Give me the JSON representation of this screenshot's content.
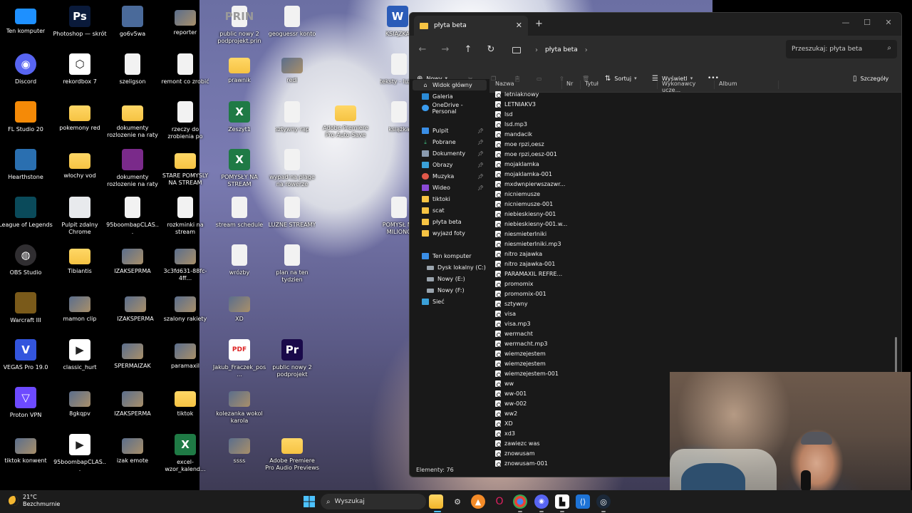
{
  "desktop": {
    "icons": [
      {
        "label": "Ten komputer",
        "icon": "monitor-icon",
        "color": "#1e90ff"
      },
      {
        "label": "Photoshop — skrót",
        "icon": "photoshop-icon",
        "color": "#0a1a3a",
        "glyph": "Ps"
      },
      {
        "label": "go6v5wa",
        "icon": "archive-icon",
        "color": "#4a6a9a"
      },
      {
        "label": "reporter",
        "icon": "image-icon"
      },
      {
        "label": "public nowy 2 podprojekt.prin",
        "icon": "file-icon",
        "glyph": "PRIN"
      },
      {
        "label": "geoguessr konto",
        "icon": "file-icon"
      },
      {
        "label": "KSIĄZKA",
        "icon": "word-icon",
        "glyph": "W"
      },
      {
        "label": "Discord",
        "icon": "discord-icon",
        "color": "#5865f2"
      },
      {
        "label": "rekordbox 7",
        "icon": "rekordbox-icon",
        "color": "#ffffff"
      },
      {
        "label": "szeligson",
        "icon": "file-icon"
      },
      {
        "label": "remont co zrobić",
        "icon": "file-icon"
      },
      {
        "label": "prawnik",
        "icon": "folder-icon"
      },
      {
        "label": "redi",
        "icon": "image-icon"
      },
      {
        "label": "teksty - luźne",
        "icon": "file-icon"
      },
      {
        "label": "FL Studio 20",
        "icon": "flstudio-icon",
        "color": "#f58a07"
      },
      {
        "label": "pokemony red",
        "icon": "folder-icon"
      },
      {
        "label": "dokumenty rozlozenie na raty",
        "icon": "folder-icon"
      },
      {
        "label": "rzeczy do zrobienia po wyplacie",
        "icon": "file-icon"
      },
      {
        "label": "Zeszyt1",
        "icon": "excel-icon",
        "glyph": "X"
      },
      {
        "label": "sztywny rap",
        "icon": "file-icon"
      },
      {
        "label": "Adobe Premiere Pro Auto-Save",
        "icon": "folder-icon"
      },
      {
        "label": "książka",
        "icon": "file-icon"
      },
      {
        "label": "Hearthstone",
        "icon": "hearthstone-icon",
        "color": "#2a6fb0"
      },
      {
        "label": "włochy vod",
        "icon": "folder-icon"
      },
      {
        "label": "dokumenty rozlozenie na raty",
        "icon": "winrar-icon",
        "color": "#7a2a8a"
      },
      {
        "label": "STARE POMYSLY NA STREAM",
        "icon": "folder-icon"
      },
      {
        "label": "POMYSŁY NA STREAM",
        "icon": "excel-icon",
        "glyph": "X"
      },
      {
        "label": "wypad na plage na rowerze",
        "icon": "file-icon"
      },
      {
        "label": "League of Legends",
        "icon": "lol-icon",
        "color": "#0a4a5a"
      },
      {
        "label": "Pulpit zdalny Chrome",
        "icon": "chrome-remote-icon",
        "color": "#e8eaed"
      },
      {
        "label": "95boombapCLAS...",
        "icon": "file-icon"
      },
      {
        "label": "rozkminki na stream",
        "icon": "file-icon"
      },
      {
        "label": "stream schedule",
        "icon": "file-icon"
      },
      {
        "label": "LUŹNE STREAMY",
        "icon": "file-icon"
      },
      {
        "label": "POMYSŁ NA MILIONG",
        "icon": "file-icon"
      },
      {
        "label": "OBS Studio",
        "icon": "obs-icon",
        "color": "#302e31"
      },
      {
        "label": "Tibiantis",
        "icon": "folder-icon"
      },
      {
        "label": "IZAKSEPRMA",
        "icon": "image-icon"
      },
      {
        "label": "3c3fd631-88fc-4ff...",
        "icon": "image-icon"
      },
      {
        "label": "wrózby",
        "icon": "file-icon"
      },
      {
        "label": "plan na ten tydzien",
        "icon": "file-icon"
      },
      {
        "label": "Warcraft III",
        "icon": "warcraft-icon",
        "color": "#7a5a1a"
      },
      {
        "label": "mamon clip",
        "icon": "image-icon"
      },
      {
        "label": "IZAKSPERMA",
        "icon": "image-icon"
      },
      {
        "label": "szalony rakiety",
        "icon": "image-icon"
      },
      {
        "label": "XD",
        "icon": "image-icon"
      },
      {
        "label": "VEGAS Pro 19.0",
        "icon": "vegas-icon",
        "color": "#3355dd",
        "glyph": "V"
      },
      {
        "label": "classic_hurt",
        "icon": "video-icon"
      },
      {
        "label": "SPERMAIZAK",
        "icon": "image-icon"
      },
      {
        "label": "paramaxil",
        "icon": "image-icon"
      },
      {
        "label": "Jakub_Fraczek_pos...",
        "icon": "pdf-icon",
        "glyph": "PDF"
      },
      {
        "label": "public nowy 2 podprojekt",
        "icon": "premiere-icon",
        "color": "#1a0a4a",
        "glyph": "Pr"
      },
      {
        "label": "Proton VPN",
        "icon": "protonvpn-icon",
        "color": "#6d4aff"
      },
      {
        "label": "8gkqpv",
        "icon": "image-icon"
      },
      {
        "label": "IZAKSPERMA",
        "icon": "image-icon"
      },
      {
        "label": "tiktok",
        "icon": "folder-icon"
      },
      {
        "label": "kolezanka wokol karola",
        "icon": "image-icon"
      },
      {
        "label": "tiktok konwent",
        "icon": "image-icon"
      },
      {
        "label": "95boombapCLAS...",
        "icon": "video-icon"
      },
      {
        "label": "izak emote",
        "icon": "image-icon"
      },
      {
        "label": "excel-wzor_kalend...",
        "icon": "excel-icon",
        "glyph": "X"
      },
      {
        "label": "ssss",
        "icon": "image-icon"
      },
      {
        "label": "Adobe Premiere Pro Audio Previews",
        "icon": "folder-icon"
      }
    ]
  },
  "explorer": {
    "tab_title": "płyta beta",
    "tab_close": "✕",
    "new_tab": "+",
    "window_controls": {
      "minimize": "—",
      "maximize": "☐",
      "close": "✕"
    },
    "breadcrumb": "płyta beta",
    "search_placeholder": "Przeszukaj: płyta beta",
    "toolbar": {
      "new": "Nowy",
      "sort": "Sortuj",
      "view": "Wyświetl",
      "more": "•••",
      "details": "Szczegóły"
    },
    "nav": {
      "home": "Widok główny",
      "gallery": "Galeria",
      "onedrive": "OneDrive - Personal",
      "desktop": "Pulpit",
      "downloads": "Pobrane",
      "documents": "Dokumenty",
      "pictures": "Obrazy",
      "music": "Muzyka",
      "videos": "Wideo",
      "tiktoki": "tiktoki",
      "scat": "scat",
      "plyta_beta": "płyta beta",
      "wyjazd_foty": "wyjazd foty",
      "this_pc": "Ten komputer",
      "disk_c": "Dysk lokalny (C:)",
      "disk_e": "Nowy (E:)",
      "disk_f": "Nowy (F:)",
      "network": "Sieć"
    },
    "columns": {
      "name": "Nazwa",
      "nr": "Nr",
      "title": "Tytuł",
      "artists": "Wykonawcy ucze...",
      "album": "Album"
    },
    "files": [
      "letniaknowy",
      "LETNIAKV3",
      "lsd",
      "lsd.mp3",
      "mandacik",
      "moe rpzi,oesz",
      "moe rpzi,oesz-001",
      "mojaklamka",
      "mojaklamka-001",
      "mxdwnpierwszazwr...",
      "nicniemusze",
      "nicniemusze-001",
      "niebieskiesny-001",
      "niebieskiesny-001.w...",
      "niesmieterlniki",
      "niesmieterlniki.mp3",
      "nitro zajawka",
      "nitro zajawka-001",
      "PARAMAXIL REFRE...",
      "promomix",
      "promomix-001",
      "sztywny",
      "visa",
      "visa.mp3",
      "wermacht",
      "wermacht.mp3",
      "wiemzejestem",
      "wiemzejestem",
      "wiemzejestem-001",
      "ww",
      "ww-001",
      "ww-002",
      "ww2",
      "XD",
      "xd3",
      "zawiezc was",
      "znowusam",
      "znowusam-001"
    ],
    "status": "Elementy: 76"
  },
  "taskbar": {
    "weather_temp": "21°C",
    "weather_desc": "Bezchmurnie",
    "search_placeholder": "Wyszukaj",
    "accent": "#0078d4"
  }
}
